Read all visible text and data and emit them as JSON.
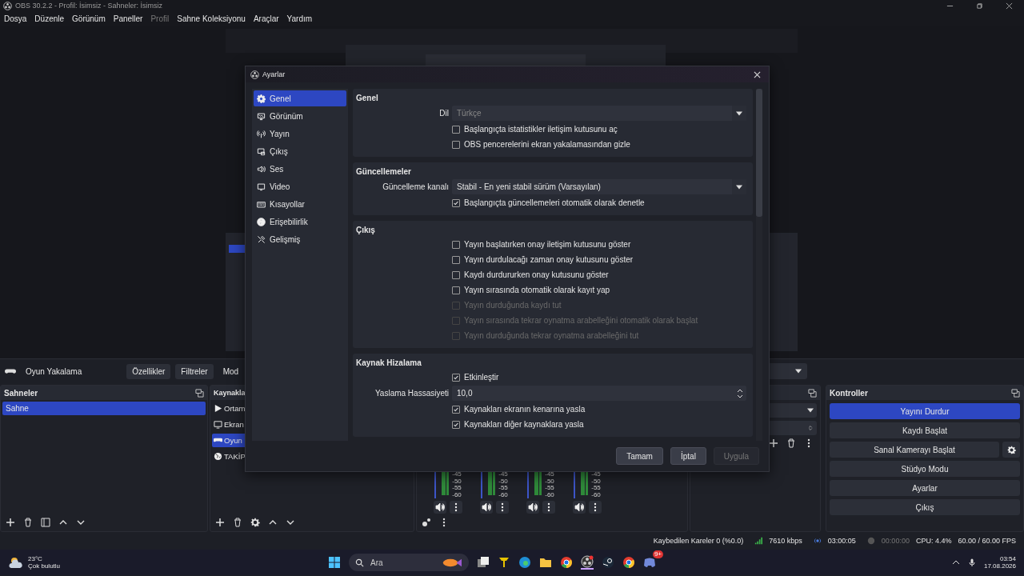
{
  "window": {
    "title": "OBS 30.2.2 - Profil: İsimsiz - Sahneler: İsimsiz"
  },
  "menu": [
    {
      "label": "Dosya",
      "disabled": false
    },
    {
      "label": "Düzenle",
      "disabled": false
    },
    {
      "label": "Görünüm",
      "disabled": false
    },
    {
      "label": "Paneller",
      "disabled": false
    },
    {
      "label": "Profil",
      "disabled": true
    },
    {
      "label": "Sahne Koleksiyonu",
      "disabled": false
    },
    {
      "label": "Araçlar",
      "disabled": false
    },
    {
      "label": "Yardım",
      "disabled": false
    }
  ],
  "source_toolbar": {
    "source": "Oyun Yakalama",
    "buttons": [
      "Özellikler",
      "Filtreler"
    ],
    "mode_label": "Mod"
  },
  "scenes": {
    "title": "Sahneler",
    "items": [
      {
        "label": "Sahne",
        "selected": true
      }
    ]
  },
  "sources": {
    "title": "Kaynakla",
    "items": [
      {
        "label": "Ortam",
        "kind": "media",
        "selected": false
      },
      {
        "label": "Ekran",
        "kind": "display",
        "selected": false
      },
      {
        "label": "Oyun",
        "kind": "game",
        "selected": true
      },
      {
        "label": "TAKİP",
        "kind": "browser",
        "selected": false
      }
    ]
  },
  "mixer": {
    "channels": [
      {
        "ticks": [
          "-45",
          "-50",
          "-55",
          "-60"
        ]
      },
      {
        "ticks": [
          "-45",
          "-50",
          "-55",
          "-60"
        ]
      },
      {
        "ticks": [
          "-45",
          "-50",
          "-55",
          "-60"
        ]
      },
      {
        "ticks": [
          "-45",
          "-50",
          "-55",
          "-60"
        ]
      }
    ]
  },
  "controls": {
    "title": "Kontroller",
    "buttons": [
      {
        "label": "Yayını Durdur",
        "selected": true,
        "kind": "plain"
      },
      {
        "label": "Kaydı Başlat",
        "selected": false,
        "kind": "plain"
      },
      {
        "label": "Sanal Kamerayı Başlat",
        "selected": false,
        "kind": "with_settings"
      },
      {
        "label": "Stüdyo Modu",
        "selected": false,
        "kind": "plain"
      },
      {
        "label": "Ayarlar",
        "selected": false,
        "kind": "plain"
      },
      {
        "label": "Çıkış",
        "selected": false,
        "kind": "plain"
      }
    ]
  },
  "status_bar": {
    "dropped_frames": "Kaybedilen Kareler 0 (%0.0)",
    "bitrate": "7610 kbps",
    "stream_time": "03:00:05",
    "record_time": "00:00:00",
    "cpu": "CPU: 4.4%",
    "fps": "60.00 / 60.00 FPS"
  },
  "taskbar": {
    "temperature": "23°C",
    "weather": "Çok bulutlu",
    "search_placeholder": "Ara",
    "badge": "9+",
    "time": "03:54",
    "date": "17.08.2026"
  },
  "settings_dialog": {
    "title": "Ayarlar",
    "sidebar": [
      {
        "label": "Genel",
        "selected": true
      },
      {
        "label": "Görünüm",
        "selected": false
      },
      {
        "label": "Yayın",
        "selected": false
      },
      {
        "label": "Çıkış",
        "selected": false
      },
      {
        "label": "Ses",
        "selected": false
      },
      {
        "label": "Video",
        "selected": false
      },
      {
        "label": "Kısayollar",
        "selected": false
      },
      {
        "label": "Erişebilirlik",
        "selected": false
      },
      {
        "label": "Gelişmiş",
        "selected": false
      }
    ],
    "sections": [
      {
        "title": "Genel",
        "rows": [
          {
            "kind": "select",
            "label": "Dil",
            "value": "Türkçe",
            "disabled": true
          },
          {
            "kind": "checkbox",
            "label": "Başlangıçta istatistikler iletişim kutusunu aç",
            "checked": false,
            "disabled": false
          },
          {
            "kind": "checkbox",
            "label": "OBS pencerelerini ekran yakalamasından gizle",
            "checked": false,
            "disabled": false
          }
        ]
      },
      {
        "title": "Güncellemeler",
        "rows": [
          {
            "kind": "select",
            "label": "Güncelleme kanalı",
            "value": "Stabil - En yeni stabil sürüm (Varsayılan)",
            "disabled": false
          },
          {
            "kind": "checkbox",
            "label": "Başlangıçta güncellemeleri otomatik olarak denetle",
            "checked": true,
            "disabled": false
          }
        ]
      },
      {
        "title": "Çıkış",
        "rows": [
          {
            "kind": "checkbox",
            "label": "Yayın başlatırken onay iletişim kutusunu göster",
            "checked": false,
            "disabled": false
          },
          {
            "kind": "checkbox",
            "label": "Yayın durdulacağı zaman onay kutusunu göster",
            "checked": false,
            "disabled": false
          },
          {
            "kind": "checkbox",
            "label": "Kaydı durdururken onay kutusunu göster",
            "checked": false,
            "disabled": false
          },
          {
            "kind": "checkbox",
            "label": "Yayın sırasında otomatik olarak kayıt yap",
            "checked": false,
            "disabled": false
          },
          {
            "kind": "checkbox",
            "label": "Yayın durduğunda kaydı tut",
            "checked": false,
            "disabled": true
          },
          {
            "kind": "checkbox",
            "label": "Yayın sırasında tekrar oynatma arabelleğini otomatik olarak başlat",
            "checked": false,
            "disabled": true
          },
          {
            "kind": "checkbox",
            "label": "Yayın durduğunda tekrar oynatma arabelleğini tut",
            "checked": false,
            "disabled": true
          }
        ]
      },
      {
        "title": "Kaynak Hizalama",
        "rows": [
          {
            "kind": "checkbox",
            "label": "Etkinleştir",
            "checked": true,
            "disabled": false
          },
          {
            "kind": "spin",
            "label": "Yaslama Hassasiyeti",
            "value": "10,0"
          },
          {
            "kind": "checkbox",
            "label": "Kaynakları ekranın kenarına yasla",
            "checked": true,
            "disabled": false
          },
          {
            "kind": "checkbox",
            "label": "Kaynakları diğer kaynaklara yasla",
            "checked": true,
            "disabled": false
          }
        ]
      }
    ],
    "buttons": [
      {
        "label": "Tamam",
        "disabled": false
      },
      {
        "label": "İptal",
        "disabled": false
      },
      {
        "label": "Uygula",
        "disabled": true
      }
    ]
  }
}
